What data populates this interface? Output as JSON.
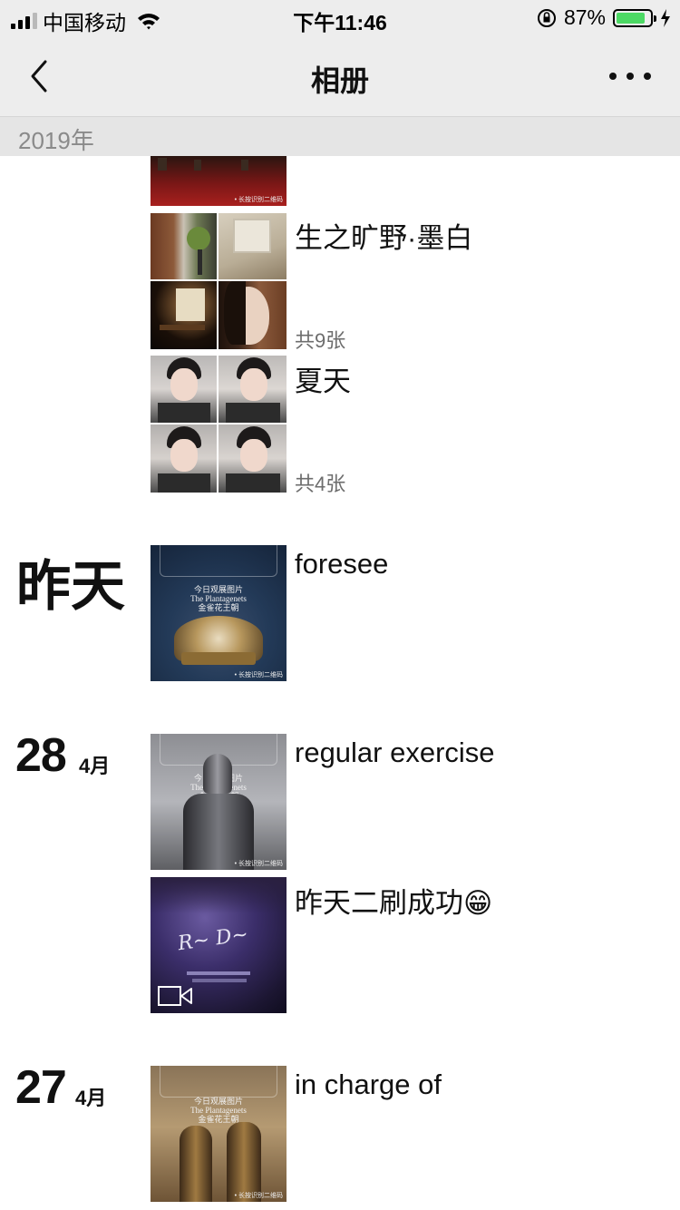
{
  "status_bar": {
    "carrier": "中国移动",
    "time": "下午11:46",
    "battery_percent": "87%",
    "battery_level": 0.87
  },
  "nav": {
    "title": "相册"
  },
  "year_header": "2019年",
  "albums": [
    {
      "title": "生之旷野·墨白",
      "count": "共9张"
    },
    {
      "title": "夏天",
      "count": "共4张"
    }
  ],
  "days": [
    {
      "label": "昨天",
      "posts": [
        {
          "title": "foresee"
        }
      ]
    },
    {
      "day": "28",
      "month": "4月",
      "posts": [
        {
          "title": "regular exercise"
        },
        {
          "title": "昨天二刷成功",
          "emoji": "😁",
          "type": "video"
        }
      ]
    },
    {
      "day": "27",
      "month": "4月",
      "posts": [
        {
          "title": "in charge of"
        }
      ]
    }
  ],
  "icons": {
    "back": "chevron-left-icon",
    "more": "more-dots-icon",
    "wifi": "wifi-icon",
    "orientation_lock": "orientation-lock-icon",
    "charging": "bolt-icon",
    "video": "video-camera-icon"
  },
  "colors": {
    "bar_bg": "#ededed",
    "year_bg": "#e5e5e5",
    "battery_fill": "#4cd964",
    "count_text": "#6d6d6d"
  }
}
